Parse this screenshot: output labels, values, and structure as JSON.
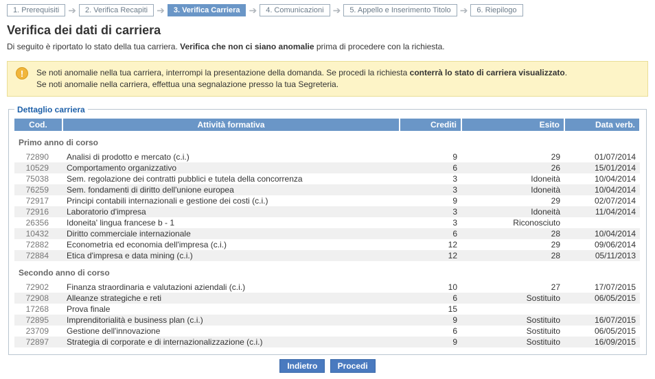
{
  "crumbs": [
    {
      "label": "1. Prerequisiti",
      "active": false
    },
    {
      "label": "2. Verifica Recapiti",
      "active": false
    },
    {
      "label": "3. Verifica Carriera",
      "active": true
    },
    {
      "label": "4. Comunicazioni",
      "active": false
    },
    {
      "label": "5. Appello e Inserimento Titolo",
      "active": false
    },
    {
      "label": "6. Riepilogo",
      "active": false
    }
  ],
  "page_title": "Verifica dei dati di carriera",
  "intro_pre": "Di seguito è riportato lo stato della tua carriera. ",
  "intro_bold": "Verifica che non ci siano anomalie",
  "intro_post": " prima di procedere con la richiesta.",
  "alert": {
    "line1_pre": "Se noti anomalie nella tua carriera, interrompi la presentazione della domanda. Se procedi la richiesta ",
    "line1_bold": "conterrà lo stato di carriera visualizzato",
    "line1_post": ".",
    "line2": "Se noti anomalie nella carriera, effettua una segnalazione presso la tua Segreteria."
  },
  "legend": "Dettaglio carriera",
  "headers": {
    "cod": "Cod.",
    "att": "Attività formativa",
    "cred": "Crediti",
    "esito": "Esito",
    "data": "Data verb."
  },
  "groups": [
    {
      "title": "Primo anno di corso",
      "rows": [
        {
          "cod": "72890",
          "att": "Analisi di prodotto e mercato (c.i.)",
          "cred": "9",
          "esito": "29",
          "data": "01/07/2014"
        },
        {
          "cod": "10529",
          "att": "Comportamento organizzativo",
          "cred": "6",
          "esito": "26",
          "data": "15/01/2014"
        },
        {
          "cod": "75038",
          "att": "Sem. regolazione dei contratti pubblici e tutela della concorrenza",
          "cred": "3",
          "esito": "Idoneità",
          "data": "10/04/2014"
        },
        {
          "cod": "76259",
          "att": "Sem. fondamenti di diritto dell'unione europea",
          "cred": "3",
          "esito": "Idoneità",
          "data": "10/04/2014"
        },
        {
          "cod": "72917",
          "att": "Principi contabili internazionali e gestione dei costi (c.i.)",
          "cred": "9",
          "esito": "29",
          "data": "02/07/2014"
        },
        {
          "cod": "72916",
          "att": "Laboratorio d'impresa",
          "cred": "3",
          "esito": "Idoneità",
          "data": "11/04/2014"
        },
        {
          "cod": "26356",
          "att": "Idoneita' lingua francese b - 1",
          "cred": "3",
          "esito": "Riconosciuto",
          "data": ""
        },
        {
          "cod": "10432",
          "att": "Diritto commerciale internazionale",
          "cred": "6",
          "esito": "28",
          "data": "10/04/2014"
        },
        {
          "cod": "72882",
          "att": "Econometria ed economia dell'impresa (c.i.)",
          "cred": "12",
          "esito": "29",
          "data": "09/06/2014"
        },
        {
          "cod": "72884",
          "att": "Etica d'impresa e data mining (c.i.)",
          "cred": "12",
          "esito": "28",
          "data": "05/11/2013"
        }
      ]
    },
    {
      "title": "Secondo anno di corso",
      "rows": [
        {
          "cod": "72902",
          "att": "Finanza straordinaria e valutazioni aziendali (c.i.)",
          "cred": "10",
          "esito": "27",
          "data": "17/07/2015"
        },
        {
          "cod": "72908",
          "att": "Alleanze strategiche e reti",
          "cred": "6",
          "esito": "Sostituito",
          "data": "06/05/2015"
        },
        {
          "cod": "17268",
          "att": "Prova finale",
          "cred": "15",
          "esito": "",
          "data": ""
        },
        {
          "cod": "72895",
          "att": "Imprenditorialità e business plan (c.i.)",
          "cred": "9",
          "esito": "Sostituito",
          "data": "16/07/2015"
        },
        {
          "cod": "23709",
          "att": "Gestione dell'innovazione",
          "cred": "6",
          "esito": "Sostituito",
          "data": "06/05/2015"
        },
        {
          "cod": "72897",
          "att": "Strategia di corporate e di internazionalizzazione (c.i.)",
          "cred": "9",
          "esito": "Sostituito",
          "data": "16/09/2015"
        }
      ]
    }
  ],
  "buttons": {
    "back": "Indietro",
    "next": "Procedi"
  }
}
